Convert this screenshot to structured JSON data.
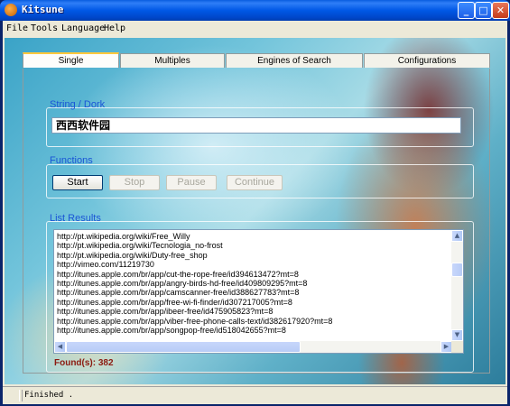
{
  "window": {
    "title": "Kitsune"
  },
  "menu": [
    "File",
    "Tools",
    "Language",
    "Help"
  ],
  "tabs": [
    "Single",
    "Multiples",
    "Engines of Search",
    "Configurations"
  ],
  "string_dork": {
    "label": "String / Dork",
    "value": "西西软件园"
  },
  "functions": {
    "label": "Functions",
    "start": "Start",
    "stop": "Stop",
    "pause": "Pause",
    "continue": "Continue"
  },
  "results": {
    "label": "List Results",
    "items": [
      "http://pt.wikipedia.org/wiki/Free_Willy",
      "http://pt.wikipedia.org/wiki/Tecnologia_no-frost",
      "http://pt.wikipedia.org/wiki/Duty-free_shop",
      "http://vimeo.com/11219730",
      "http://itunes.apple.com/br/app/cut-the-rope-free/id394613472?mt=8",
      "http://itunes.apple.com/br/app/angry-birds-hd-free/id409809295?mt=8",
      "http://itunes.apple.com/br/app/camscanner-free/id388627783?mt=8",
      "http://itunes.apple.com/br/app/free-wi-fi-finder/id307217005?mt=8",
      "http://itunes.apple.com/br/app/ibeer-free/id475905823?mt=8",
      "http://itunes.apple.com/br/app/viber-free-phone-calls-text/id382617920?mt=8",
      "http://itunes.apple.com/br/app/songpop-free/id518042655?mt=8"
    ],
    "found": "Found(s): 382"
  },
  "status": {
    "text": "Finished ."
  },
  "colors": {
    "group_title": "#1a55d6",
    "found": "#8b1a10",
    "titlebar": "#0058e6"
  },
  "icons": {
    "app": "kitsune-icon",
    "minimize": "minimize-icon",
    "maximize": "maximize-icon",
    "close": "close-icon"
  }
}
